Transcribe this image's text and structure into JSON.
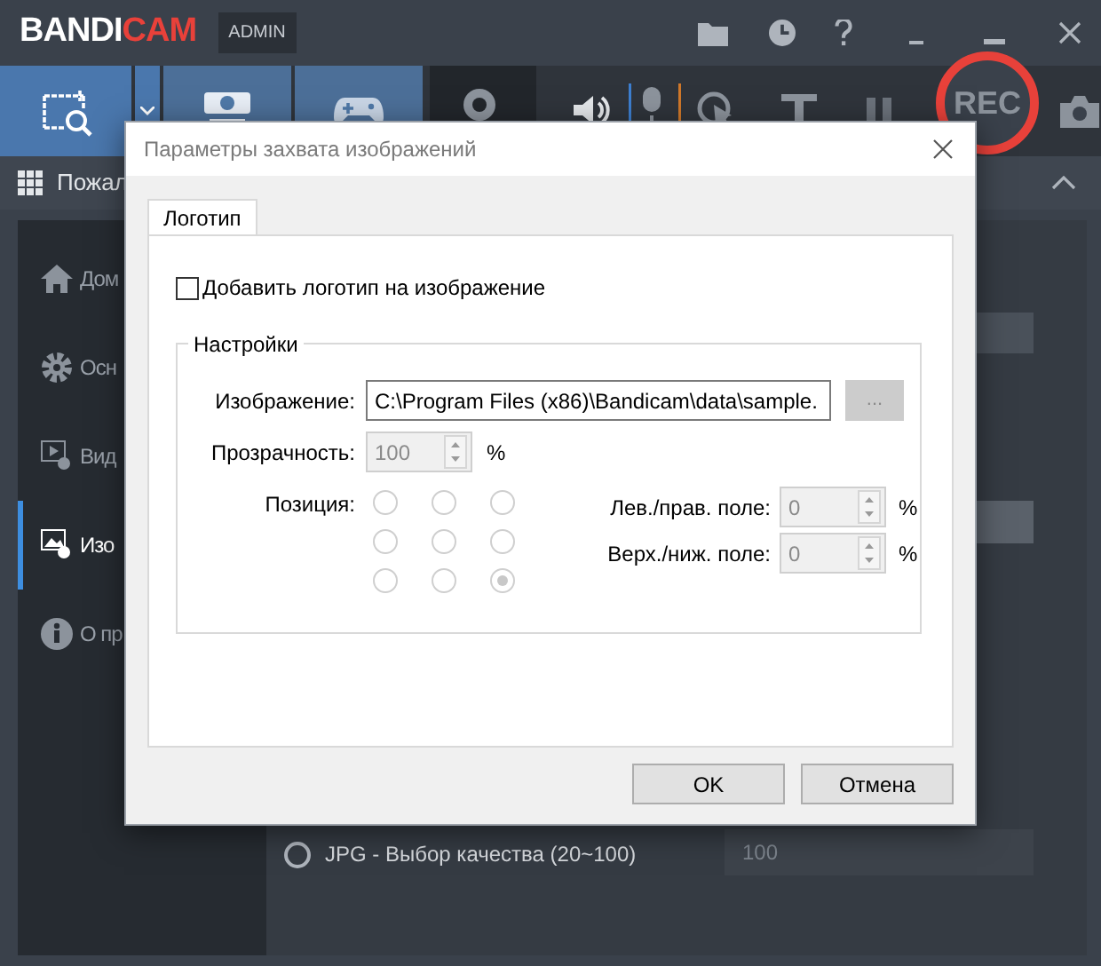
{
  "app": {
    "logo_parts": [
      {
        "text": "BANDI",
        "color": "#ffffff"
      },
      {
        "text": "CAM",
        "color": "#e8413a"
      }
    ],
    "badge": "ADMIN"
  },
  "toolbar": {
    "modes": [
      {
        "kind": "screen",
        "selected": true
      },
      {
        "kind": "hdmi",
        "selected": false
      },
      {
        "kind": "game",
        "selected": false
      }
    ],
    "rec": "REC"
  },
  "header": {
    "title": "Пожал"
  },
  "sidebar": {
    "items": [
      {
        "kind": "home",
        "label": "Дом",
        "selected": false
      },
      {
        "kind": "gear",
        "label": "Осн",
        "selected": false
      },
      {
        "kind": "video",
        "label": "Вид",
        "selected": false
      },
      {
        "kind": "image",
        "label": "Изо",
        "selected": true
      },
      {
        "kind": "info",
        "label": "О пр",
        "selected": false
      }
    ]
  },
  "content": {
    "jpg_option": {
      "label": "JPG - Выбор качества (20~100)",
      "selected": false,
      "value": "100"
    }
  },
  "dialog": {
    "title": "Параметры захвата изображений",
    "tabs": [
      {
        "label": "Логотип",
        "selected": true
      }
    ],
    "add_logo": {
      "label": "Добавить логотип на изображение",
      "checked": false
    },
    "group": {
      "title": "Настройки",
      "image": {
        "label": "Изображение:",
        "value": "C:\\Program Files (x86)\\Bandicam\\data\\sample.",
        "browse": "...",
        "disabled": true
      },
      "transparency": {
        "label": "Прозрачность:",
        "value": "100",
        "unit": "%",
        "disabled": true
      },
      "position": {
        "label": "Позиция:",
        "disabled": true,
        "options": [
          {
            "selected": false
          },
          {
            "selected": false
          },
          {
            "selected": false
          },
          {
            "selected": false
          },
          {
            "selected": false
          },
          {
            "selected": false
          },
          {
            "selected": false
          },
          {
            "selected": false
          },
          {
            "selected": true
          }
        ]
      },
      "margins": [
        {
          "label": "Лев./прав. поле:",
          "value": "0",
          "unit": "%",
          "disabled": true
        },
        {
          "label": "Верх./ниж. поле:",
          "value": "0",
          "unit": "%",
          "disabled": true
        }
      ]
    },
    "buttons": [
      "OK",
      "Отмена"
    ]
  }
}
